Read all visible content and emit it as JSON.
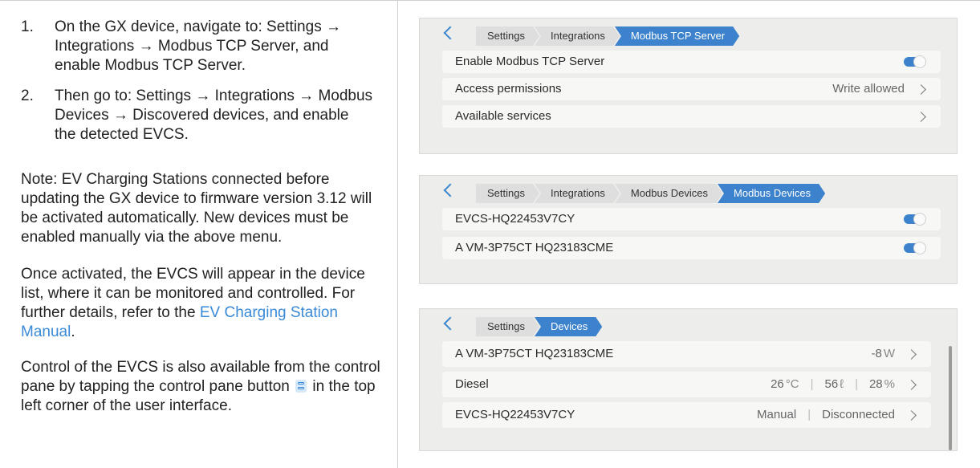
{
  "instructions": {
    "steps": [
      {
        "num": "1.",
        "text": "On the GX device, navigate to: Settings → Integrations → Modbus TCP Server, and enable Modbus TCP Server."
      },
      {
        "num": "2.",
        "text": "Then go to: Settings → Integrations → Modbus Devices → Discovered devices, and enable the detected EVCS."
      }
    ],
    "note": "Note: EV Charging Stations connected before updating the GX device to firmware version 3.12 will be activated automatically. New devices must be enabled manually via the above menu.",
    "activated_prefix": "Once activated, the EVCS will appear in the device list, where it can be monitored and controlled. For further details, refer to the ",
    "manual_link": "EV Charging Station Manual",
    "activated_suffix": ".",
    "control_prefix": "Control of the EVCS is also available from the control pane by tapping the control pane button ",
    "control_suffix": " in the top left corner of the user interface."
  },
  "panel1": {
    "breadcrumb": [
      "Settings",
      "Integrations",
      "Modbus TCP Server"
    ],
    "rows": [
      {
        "label": "Enable Modbus TCP Server",
        "toggle_on": true
      },
      {
        "label": "Access permissions",
        "value": "Write allowed"
      },
      {
        "label": "Available services"
      }
    ]
  },
  "panel2": {
    "breadcrumb": [
      "Settings",
      "Integrations",
      "Modbus Devices",
      "Modbus Devices"
    ],
    "rows": [
      {
        "label": "EVCS-HQ22453V7CY",
        "toggle_on": true
      },
      {
        "label": "A VM-3P75CT HQ23183CME",
        "toggle_on": true
      }
    ]
  },
  "panel3": {
    "breadcrumb": [
      "Settings",
      "Devices"
    ],
    "rows": [
      {
        "label": "A VM-3P75CT HQ23183CME",
        "power_value": "-8",
        "power_unit": "W"
      },
      {
        "label": "Diesel",
        "temp_value": "26",
        "temp_unit": "°C",
        "level_value": "56",
        "level_unit": "ℓ",
        "pct_value": "28",
        "pct_unit": "%"
      },
      {
        "label": "EVCS-HQ22453V7CY",
        "mode": "Manual",
        "status": "Disconnected"
      }
    ]
  },
  "colors": {
    "accent": "#3c82cc",
    "link": "#3a8ad8",
    "panel_bg": "#ededeb"
  },
  "icons": {
    "back": "chevron-left-icon",
    "row_nav": "chevron-right-icon",
    "control_pane": "control-pane-icon"
  }
}
